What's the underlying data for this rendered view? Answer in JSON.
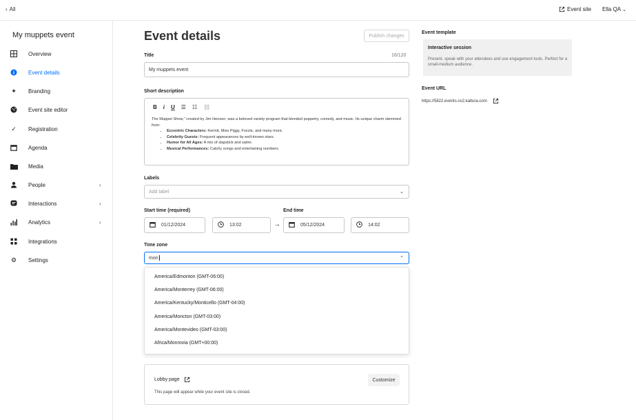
{
  "topbar": {
    "back_label": "All",
    "event_site_label": "Event site",
    "user_name": "Ella QA"
  },
  "sidebar": {
    "event_name": "My muppets event",
    "items": [
      {
        "label": "Overview",
        "icon": "grid-icon",
        "has_arrow": false,
        "active": false
      },
      {
        "label": "Event details",
        "icon": "info-icon",
        "has_arrow": false,
        "active": true
      },
      {
        "label": "Branding",
        "icon": "sparkle-icon",
        "has_arrow": false,
        "active": false
      },
      {
        "label": "Event site editor",
        "icon": "globe-icon",
        "has_arrow": false,
        "active": false
      },
      {
        "label": "Registration",
        "icon": "check-icon",
        "has_arrow": false,
        "active": false
      },
      {
        "label": "Agenda",
        "icon": "calendar-icon",
        "has_arrow": false,
        "active": false
      },
      {
        "label": "Media",
        "icon": "folder-icon",
        "has_arrow": false,
        "active": false
      },
      {
        "label": "People",
        "icon": "person-icon",
        "has_arrow": true,
        "active": false
      },
      {
        "label": "Interactions",
        "icon": "chat-icon",
        "has_arrow": true,
        "active": false
      },
      {
        "label": "Analytics",
        "icon": "bar-chart-icon",
        "has_arrow": true,
        "active": false
      },
      {
        "label": "Integrations",
        "icon": "integrations-icon",
        "has_arrow": false,
        "active": false
      },
      {
        "label": "Settings",
        "icon": "gear-icon",
        "has_arrow": false,
        "active": false
      }
    ]
  },
  "main": {
    "page_title": "Event details",
    "publish_label": "Publish changes",
    "title_label": "Title",
    "title_counter": "16/120",
    "title_value": "My muppets event",
    "short_description_label": "Short description",
    "description": {
      "intro": "The Muppet Show,\" created by Jim Henson, was a beloved variety program that blended puppetry, comedy, and music. Its unique charm stemmed from:",
      "bullets": [
        {
          "bold": "Eccentric Characters:",
          "text": " Kermit, Miss Piggy, Fozzie, and many more."
        },
        {
          "bold": "Celebrity Guests:",
          "text": " Frequent appearances by well-known stars."
        },
        {
          "bold": "Humor for All Ages:",
          "text": " A mix of slapstick and satire."
        },
        {
          "bold": "Musical Performances:",
          "text": " Catchy songs and entertaining numbers."
        }
      ]
    },
    "labels_label": "Labels",
    "labels_placeholder": "Add label",
    "start_time_label": "Start time (required)",
    "end_time_label": "End time",
    "start_date": "01/12/2024",
    "start_time": "13:02",
    "end_date": "05/12/2024",
    "end_time": "14:02",
    "timezone_label": "Time zone",
    "timezone_value": "mon",
    "timezone_options": [
      "America/Edmonton (GMT-06:00)",
      "America/Monterrey (GMT-06:00)",
      "America/Kentucky/Monticello (GMT-04:00)",
      "America/Moncton (GMT-03:00)",
      "America/Montevideo (GMT-03:00)",
      "Africa/Monrovia (GMT+00:00)"
    ],
    "lobby_title": "Lobby page",
    "lobby_desc": "This page will appear while your event site is closed.",
    "customize_label": "Customize"
  },
  "right_panel": {
    "template_label": "Event template",
    "template_name": "Interactive session",
    "template_desc": "Present, speak with your attendees and use engagement tools. Perfect for a small-medium audience.",
    "url_label": "Event URL",
    "url_value": "https://5822.events.nv2.kaltura.com"
  },
  "colors": {
    "accent": "#006efa",
    "border": "#c7c7c7",
    "template_bg": "#f0f0f0"
  }
}
